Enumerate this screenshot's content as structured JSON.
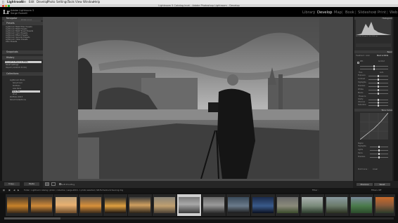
{
  "menubar": {
    "app": "Lightroom",
    "items": [
      "File",
      "Edit",
      "Develop",
      "Photo",
      "Settings",
      "Tools",
      "View",
      "Window",
      "Help"
    ]
  },
  "window": {
    "title": "Lightroom 5 Catalog.lrcat - Adobe Photoshop Lightroom - Develop"
  },
  "identity": {
    "logo": "Lr",
    "sub": "Adobe Lightroom 5",
    "user": "Serge Ramelli"
  },
  "modules": [
    "Library",
    "Develop",
    "Map",
    "Book",
    "Slideshow",
    "Print",
    "Web"
  ],
  "active_module": "Develop",
  "left_panel": {
    "navigator": "Navigator",
    "navigator_zoom": "FIT  FILL  1:1  3:1",
    "presets": "Presets",
    "preset_items": [
      "Lightroom B&W Filter Presets",
      "Lightroom B&W Presets",
      "Lightroom B&W Toned Presets",
      "Lightroom Color Presets",
      "Lightroom Effect Presets",
      "Lightroom General Presets",
      "Lightroom Video Presets",
      "User Presets"
    ],
    "snapshots": "Snapshots",
    "history": "History",
    "history_items": [
      "Convert to Black & White",
      "Reset settings",
      "Import (1/10/14 21:04)"
    ],
    "collections": "Collections",
    "collection_items": [
      "Lightroom Photo",
      "Smart Coll",
      "Portfolio",
      "Like Paris",
      "Paris Fav",
      "Print",
      "Portfolio 2013",
      "Smart Collections"
    ]
  },
  "right_panel": {
    "histogram": "Histogram",
    "photo_info": "ISO 100    35 mm    f / 5.6    1/20 sec",
    "basic": "Basic",
    "treatment_label": "Treatment :",
    "treatment_color": "Color",
    "treatment_bw": "Black & White",
    "wb_label": "WB :",
    "wb_value": "As Shot",
    "tone_label": "Tone",
    "tone_auto": "Auto",
    "tone_sliders": [
      "Exposure",
      "Contrast",
      "Highlights",
      "Shadows",
      "Whites",
      "Blacks"
    ],
    "presence_label": "Presence",
    "presence_sliders": [
      "Clarity",
      "Vibrance",
      "Saturation"
    ],
    "tone_curve": "Tone Curve",
    "curve_region": "Region",
    "curve_sliders": [
      "Highlights",
      "Lights",
      "Darks",
      "Shadows"
    ],
    "point_curve_label": "Point Curve :",
    "point_curve_value": "Linear",
    "previous_button": "Previous",
    "reset_button": "Reset"
  },
  "toolbar": {
    "copy_button": "Copy...",
    "paste_button": "Paste",
    "soft_proofing": "Soft Proofing"
  },
  "filmstrip_bar": {
    "path": "Folder : Lightroom catalog / photo / collection / serge-2016 - 1 photo selected / GB-Fermeline-Scheuning.dng",
    "filter_label": "Filter :",
    "filter_value": "Filters Off"
  },
  "colors": {
    "panel_bg": "#2b2b2b",
    "center_bg": "#494949",
    "active_module": "#e6e6e6"
  }
}
